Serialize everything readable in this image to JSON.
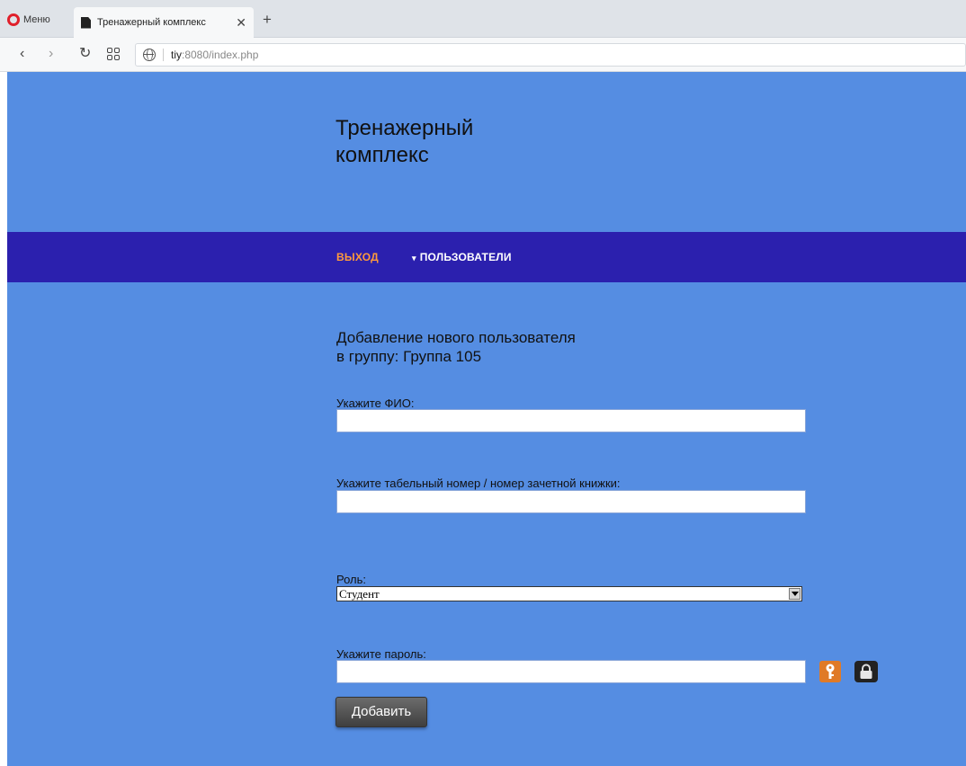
{
  "browser": {
    "menu_label": "Меню",
    "tab_title": "Тренажерный комплекс",
    "tab_close": "✕",
    "new_tab": "+",
    "url_host": "tiy",
    "url_rest": ":8080/index.php"
  },
  "site": {
    "title": "Тренажерный комплекс"
  },
  "nav": {
    "exit_label": "ВЫХОД",
    "users_label": "ПОЛЬЗОВАТЕЛИ"
  },
  "form": {
    "heading_line1": "Добавление нового пользователя",
    "heading_line2": "в группу: Группа 105",
    "fio_label": "Укажите ФИО:",
    "fio_value": "",
    "tab_number_label": "Укажите табельный номер / номер зачетной книжки:",
    "tab_number_value": "",
    "role_label": "Роль:",
    "role_selected": "Студент",
    "password_label": "Укажите пароль:",
    "password_value": "",
    "submit_label": "Добавить"
  },
  "colors": {
    "page_background": "#558de2",
    "navbar": "#2b20ae",
    "exit_link": "#ff9a3c",
    "key_button": "#e07a27"
  }
}
